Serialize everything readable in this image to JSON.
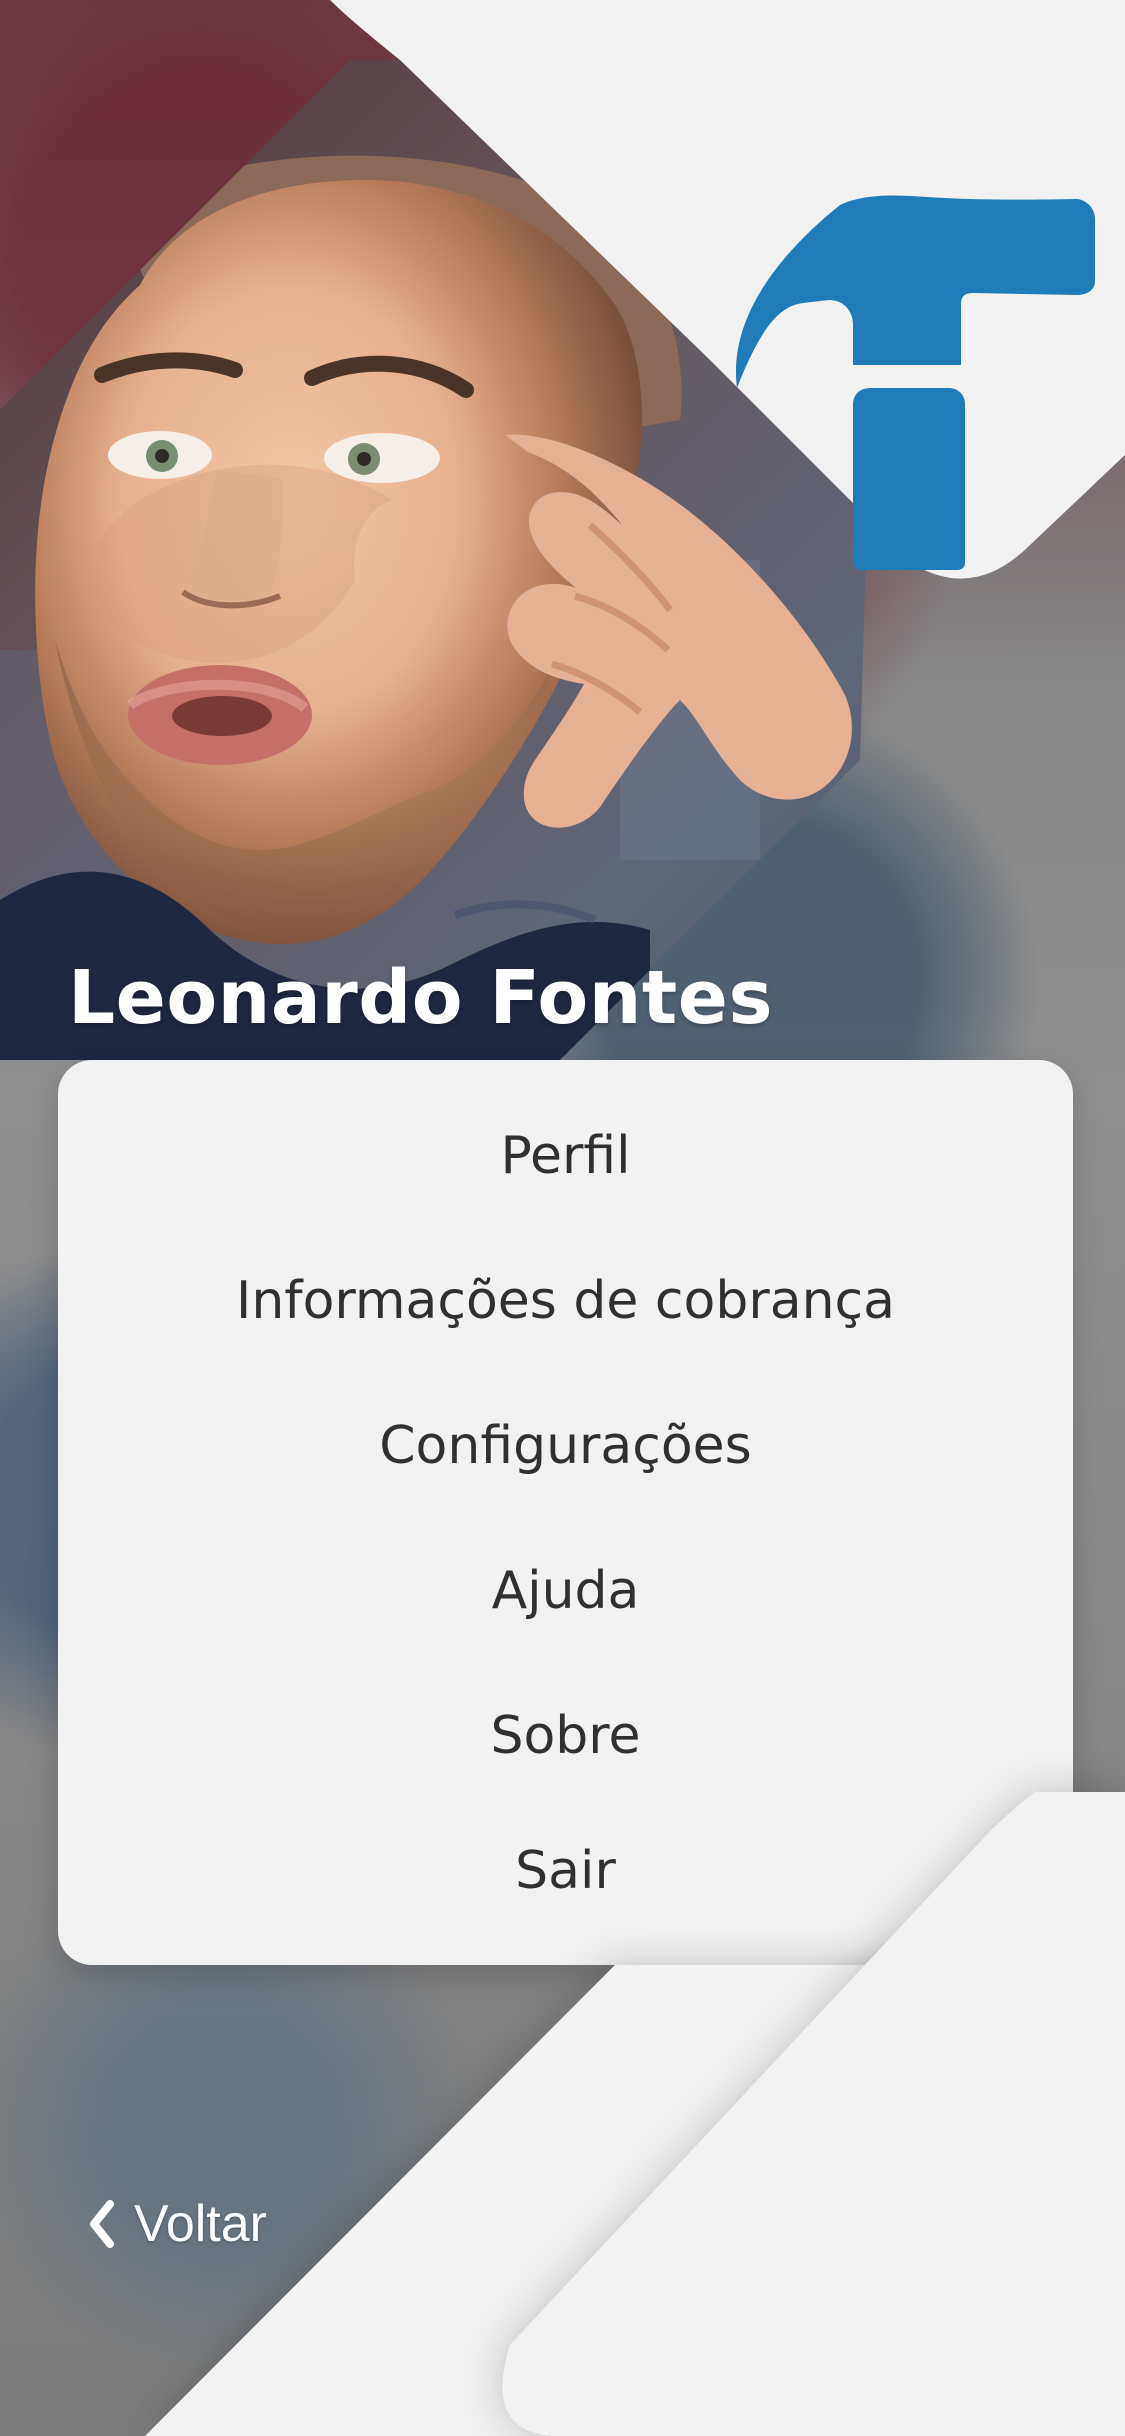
{
  "profile": {
    "name": "Leonardo Fontes"
  },
  "menu": {
    "items": [
      "Perfil",
      "Informações de cobrança",
      "Configurações",
      "Ajuda",
      "Sobre",
      "Sair"
    ]
  },
  "navigation": {
    "back_label": "Voltar"
  },
  "icons": {
    "logo": "hammer-logo-icon",
    "back": "chevron-left-icon"
  },
  "colors": {
    "brand_blue": "#1f7cb9",
    "card_bg": "#f2f2f2",
    "text_dark": "#303030",
    "header_red": "#6f3440"
  }
}
